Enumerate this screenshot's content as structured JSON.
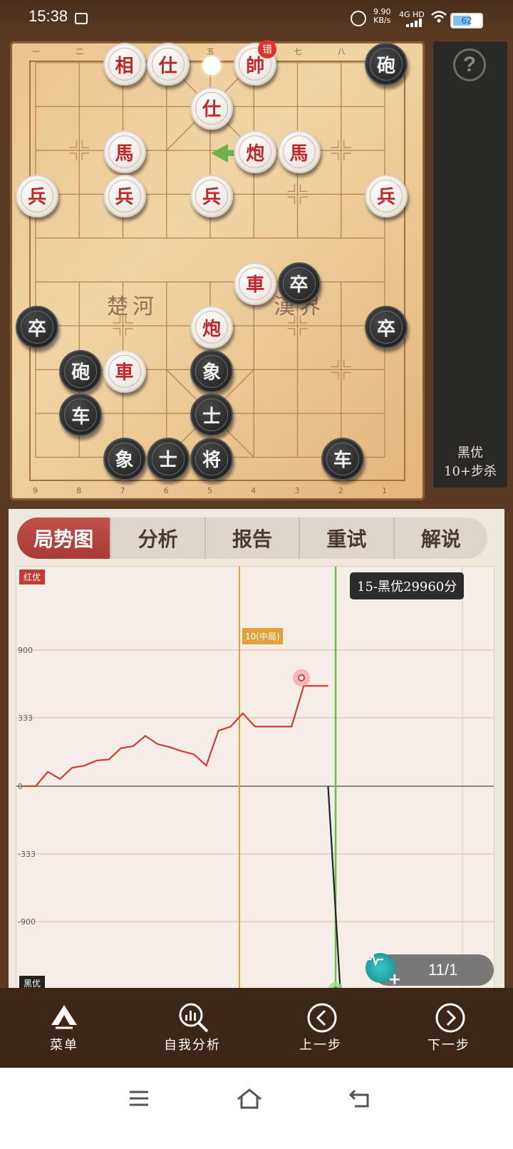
{
  "status_bar": {
    "time": "15:38",
    "speed_value": "9.90",
    "speed_unit": "KB/s",
    "network": "4G HD",
    "battery": "62"
  },
  "board": {
    "top_coords": [
      "一",
      "二",
      "三",
      "四",
      "五",
      "六",
      "七",
      "八",
      "九"
    ],
    "bottom_coords": [
      "9",
      "8",
      "7",
      "6",
      "5",
      "4",
      "3",
      "2",
      "1"
    ],
    "river_left": "楚河",
    "river_right": "漢界",
    "error_badge": "错",
    "pieces": [
      {
        "char": "相",
        "side": "red",
        "col": 2,
        "row": 0
      },
      {
        "char": "仕",
        "side": "red",
        "col": 3,
        "row": 0
      },
      {
        "char": "帥",
        "side": "red",
        "col": 5,
        "row": 0
      },
      {
        "char": "砲",
        "side": "black",
        "col": 8,
        "row": 0
      },
      {
        "char": "仕",
        "side": "red",
        "col": 4,
        "row": 1
      },
      {
        "char": "馬",
        "side": "red",
        "col": 2,
        "row": 2
      },
      {
        "char": "炮",
        "side": "red",
        "col": 5,
        "row": 2
      },
      {
        "char": "馬",
        "side": "red",
        "col": 6,
        "row": 2
      },
      {
        "char": "兵",
        "side": "red",
        "col": 0,
        "row": 3
      },
      {
        "char": "兵",
        "side": "red",
        "col": 2,
        "row": 3
      },
      {
        "char": "兵",
        "side": "red",
        "col": 4,
        "row": 3
      },
      {
        "char": "兵",
        "side": "red",
        "col": 8,
        "row": 3
      },
      {
        "char": "車",
        "side": "red",
        "col": 5,
        "row": 5
      },
      {
        "char": "卒",
        "side": "black",
        "col": 6,
        "row": 5
      },
      {
        "char": "卒",
        "side": "black",
        "col": 0,
        "row": 6
      },
      {
        "char": "炮",
        "side": "red",
        "col": 4,
        "row": 6
      },
      {
        "char": "卒",
        "side": "black",
        "col": 8,
        "row": 6
      },
      {
        "char": "砲",
        "side": "black",
        "col": 1,
        "row": 7
      },
      {
        "char": "車",
        "side": "red",
        "col": 2,
        "row": 7
      },
      {
        "char": "象",
        "side": "black",
        "col": 4,
        "row": 7
      },
      {
        "char": "车",
        "side": "black",
        "col": 1,
        "row": 8
      },
      {
        "char": "士",
        "side": "black",
        "col": 4,
        "row": 8
      },
      {
        "char": "象",
        "side": "black",
        "col": 2,
        "row": 9
      },
      {
        "char": "士",
        "side": "black",
        "col": 3,
        "row": 9
      },
      {
        "char": "将",
        "side": "black",
        "col": 4,
        "row": 9
      },
      {
        "char": "车",
        "side": "black",
        "col": 7,
        "row": 9
      }
    ]
  },
  "side_panel": {
    "help_icon": "?",
    "line1": "黑优",
    "line2": "10+步杀"
  },
  "tabs": [
    "局势图",
    "分析",
    "报告",
    "重试",
    "解说"
  ],
  "chart_data": {
    "type": "line",
    "top_label": "红优",
    "bottom_label": "黑优",
    "y_ticks": [
      "900",
      "333",
      "0",
      "-333",
      "-900"
    ],
    "phase_marker": {
      "move": 10,
      "label": "10(中局)"
    },
    "tooltip": "15-黑优29960分",
    "highlight_move": 13,
    "current_move": 15,
    "series": [
      {
        "color": "#d23a36",
        "points": [
          [
            0,
            0
          ],
          [
            1,
            0
          ],
          [
            2,
            70
          ],
          [
            3,
            35
          ],
          [
            4,
            90
          ],
          [
            5,
            100
          ],
          [
            6,
            125
          ],
          [
            7,
            130
          ],
          [
            8,
            185
          ],
          [
            9,
            195
          ],
          [
            10,
            245
          ],
          [
            11,
            205
          ],
          [
            12,
            190
          ],
          [
            13,
            170
          ],
          [
            14,
            155
          ],
          [
            15,
            100
          ],
          [
            16,
            270
          ],
          [
            17,
            290
          ],
          [
            18,
            370
          ],
          [
            19,
            290
          ],
          [
            20,
            290
          ],
          [
            21,
            290
          ],
          [
            22,
            290
          ],
          [
            23,
            600
          ],
          [
            24,
            600
          ],
          [
            25,
            600
          ]
        ]
      },
      {
        "color": "#222222",
        "points": [
          [
            25,
            0
          ],
          [
            26,
            -2000
          ]
        ]
      }
    ]
  },
  "counter": {
    "value": "11/1"
  },
  "bottom_nav": [
    {
      "label": "菜单",
      "icon": "menu-icon"
    },
    {
      "label": "自我分析",
      "icon": "analysis-icon"
    },
    {
      "label": "上一步",
      "icon": "prev-icon"
    },
    {
      "label": "下一步",
      "icon": "next-icon"
    }
  ]
}
